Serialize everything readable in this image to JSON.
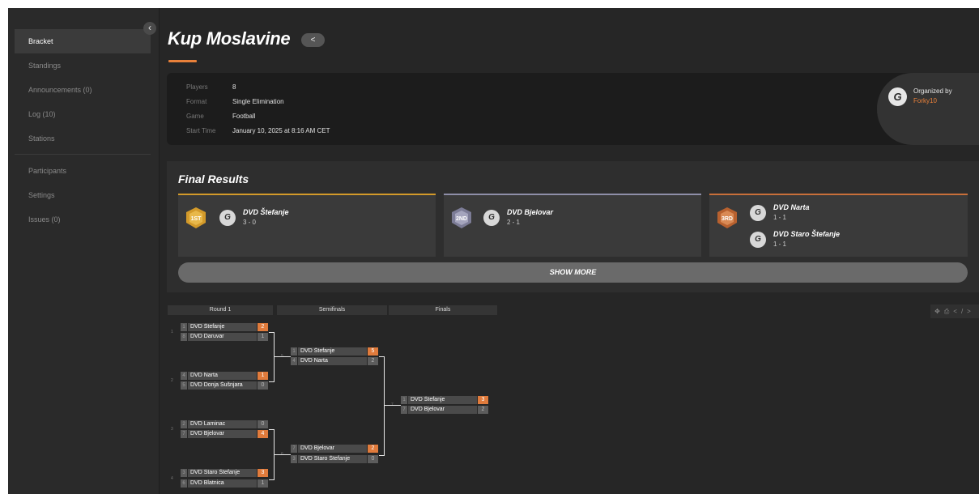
{
  "sidebar": {
    "items": [
      {
        "label": "Bracket",
        "active": true
      },
      {
        "label": "Standings"
      },
      {
        "label": "Announcements (0)"
      },
      {
        "label": "Log (10)"
      },
      {
        "label": "Stations"
      },
      {
        "label": "Participants"
      },
      {
        "label": "Settings"
      },
      {
        "label": "Issues (0)"
      }
    ],
    "collapse_icon": "chevron-left-icon"
  },
  "header": {
    "title": "Kup Moslavine",
    "share_icon": "share-icon",
    "accent_color": "#e8803a"
  },
  "info": {
    "players_label": "Players",
    "players_value": "8",
    "format_label": "Format",
    "format_value": "Single Elimination",
    "game_label": "Game",
    "game_value": "Football",
    "start_label": "Start Time",
    "start_value": "January 10, 2025 at 8:16 AM CET"
  },
  "organizer": {
    "label": "Organized by",
    "name": "Forky10"
  },
  "results": {
    "title": "Final Results",
    "places": [
      {
        "badge": "1ST",
        "color": "#d39a2a",
        "teams": [
          {
            "name": "DVD Štefanje",
            "score": "3 - 0"
          }
        ]
      },
      {
        "badge": "2ND",
        "color": "#8e8ea8",
        "teams": [
          {
            "name": "DVD Bjelovar",
            "score": "2 - 1"
          }
        ]
      },
      {
        "badge": "3RD",
        "color": "#c86f3a",
        "teams": [
          {
            "name": "DVD Narta",
            "score": "1 - 1"
          },
          {
            "name": "DVD Staro Štefanje",
            "score": "1 - 1"
          }
        ]
      }
    ],
    "show_more": "SHOW MORE"
  },
  "bracket": {
    "rounds": [
      "Round 1",
      "Semifinals",
      "Finals"
    ],
    "matches": [
      {
        "num": "1",
        "rows": [
          {
            "seed": "1",
            "name": "DVD Štefanje",
            "score": "2",
            "win": true
          },
          {
            "seed": "8",
            "name": "DVD Daruvar",
            "score": "1",
            "win": false
          }
        ]
      },
      {
        "num": "2",
        "rows": [
          {
            "seed": "4",
            "name": "DVD Narta",
            "score": "1",
            "win": true
          },
          {
            "seed": "5",
            "name": "DVD Donja Šušnjara",
            "score": "0",
            "win": false
          }
        ]
      },
      {
        "num": "3",
        "rows": [
          {
            "seed": "2",
            "name": "DVD Laminac",
            "score": "0",
            "win": false
          },
          {
            "seed": "7",
            "name": "DVD Bjelovar",
            "score": "4",
            "win": true
          }
        ]
      },
      {
        "num": "4",
        "rows": [
          {
            "seed": "3",
            "name": "DVD Staro Štefanje",
            "score": "3",
            "win": true
          },
          {
            "seed": "6",
            "name": "DVD Blatnica",
            "score": "1",
            "win": false
          }
        ]
      },
      {
        "num": "5",
        "rows": [
          {
            "seed": "1",
            "name": "DVD Štefanje",
            "score": "5",
            "win": true
          },
          {
            "seed": "4",
            "name": "DVD Narta",
            "score": "2",
            "win": false
          }
        ]
      },
      {
        "num": "6",
        "rows": [
          {
            "seed": "7",
            "name": "DVD Bjelovar",
            "score": "2",
            "win": true
          },
          {
            "seed": "3",
            "name": "DVD Staro Štefanje",
            "score": "0",
            "win": false
          }
        ]
      },
      {
        "num": "7",
        "rows": [
          {
            "seed": "1",
            "name": "DVD Štefanje",
            "score": "3",
            "win": true
          },
          {
            "seed": "7",
            "name": "DVD Bjelovar",
            "score": "2",
            "win": false
          }
        ]
      }
    ],
    "tools": [
      "move-icon",
      "print-icon",
      "embed-icon"
    ]
  }
}
